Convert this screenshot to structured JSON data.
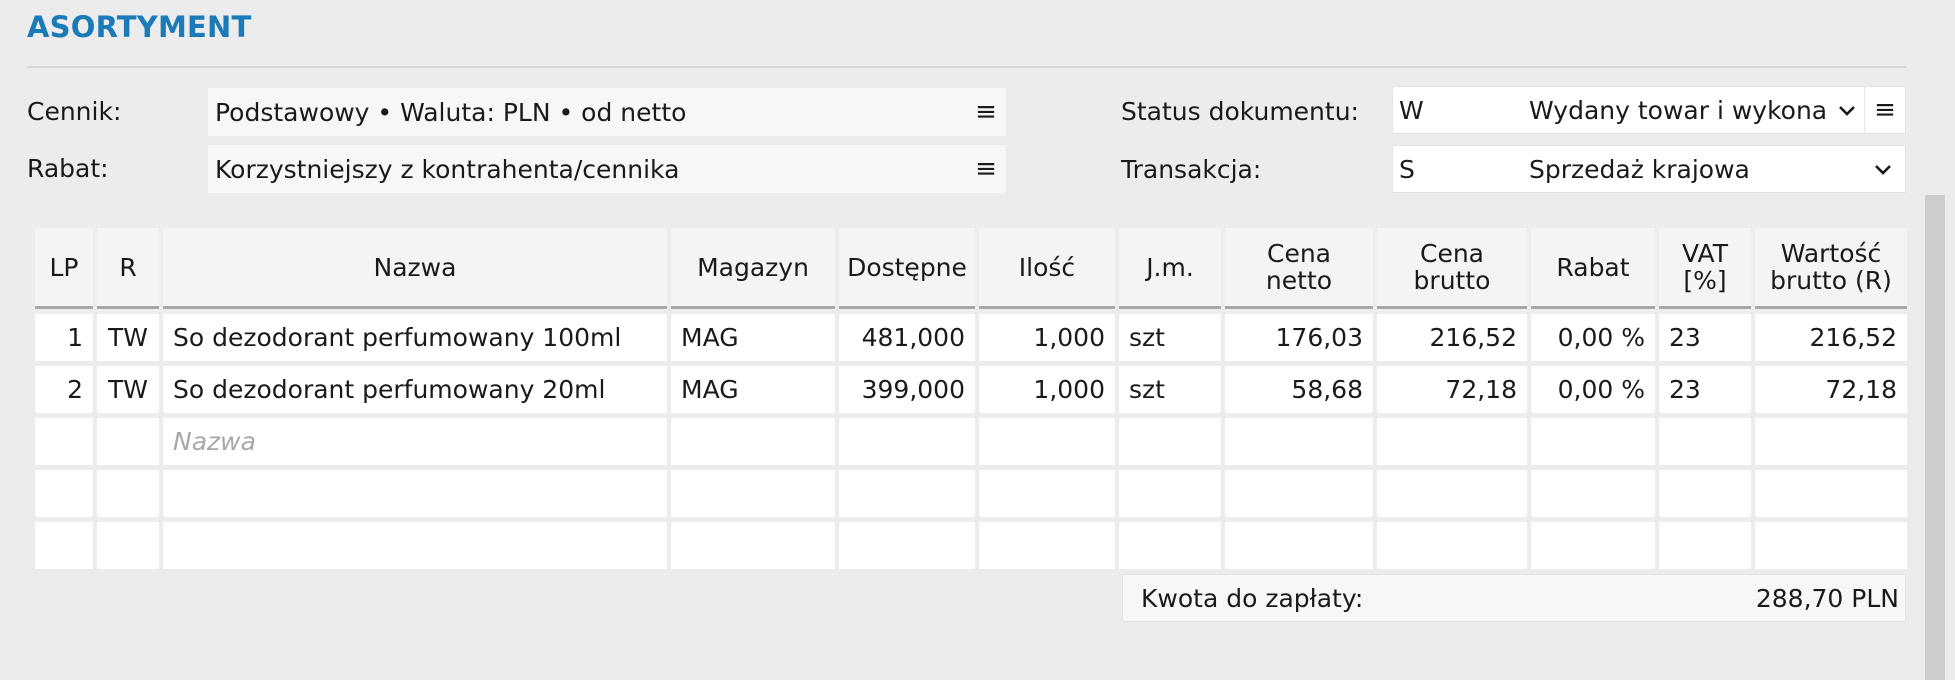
{
  "section": {
    "title": "ASORTYMENT"
  },
  "form": {
    "cennik_label": "Cennik:",
    "cennik_value": "Podstawowy • Waluta: PLN • od netto",
    "rabat_label": "Rabat:",
    "rabat_value": "Korzystniejszy z kontrahenta/cennika",
    "status_label": "Status dokumentu:",
    "status_code": "W",
    "status_value": "Wydany towar i wykona",
    "transakcja_label": "Transakcja:",
    "transakcja_code": "S",
    "transakcja_value": "Sprzedaż krajowa",
    "menu_icon_glyph": "≡",
    "chevron_glyph": "⌄"
  },
  "table": {
    "columns": {
      "lp": "LP",
      "r": "R",
      "nazwa": "Nazwa",
      "magazyn": "Magazyn",
      "dostepne": "Dostępne",
      "ilosc": "Ilość",
      "jm": "J.m.",
      "cena_netto_1": "Cena",
      "cena_netto_2": "netto",
      "cena_brutto_1": "Cena",
      "cena_brutto_2": "brutto",
      "rabat": "Rabat",
      "vat_1": "VAT",
      "vat_2": "[%]",
      "wartosc_1": "Wartość",
      "wartosc_2": "brutto (R)"
    },
    "rows": [
      {
        "lp": "1",
        "r": "TW",
        "nazwa": "So dezodorant perfumowany 100ml",
        "magazyn": "MAG",
        "dostepne": "481,000",
        "ilosc": "1,000",
        "jm": "szt",
        "cena_netto": "176,03",
        "cena_brutto": "216,52",
        "rabat": "0,00 %",
        "vat": "23",
        "wartosc": "216,52"
      },
      {
        "lp": "2",
        "r": "TW",
        "nazwa": "So dezodorant perfumowany 20ml",
        "magazyn": "MAG",
        "dostepne": "399,000",
        "ilosc": "1,000",
        "jm": "szt",
        "cena_netto": "58,68",
        "cena_brutto": "72,18",
        "rabat": "0,00 %",
        "vat": "23",
        "wartosc": "72,18"
      }
    ],
    "new_row_placeholder": "Nazwa"
  },
  "summary": {
    "label": "Kwota do zapłaty:",
    "value": "288,70 PLN"
  },
  "colors": {
    "accent": "#1b7ab8"
  }
}
